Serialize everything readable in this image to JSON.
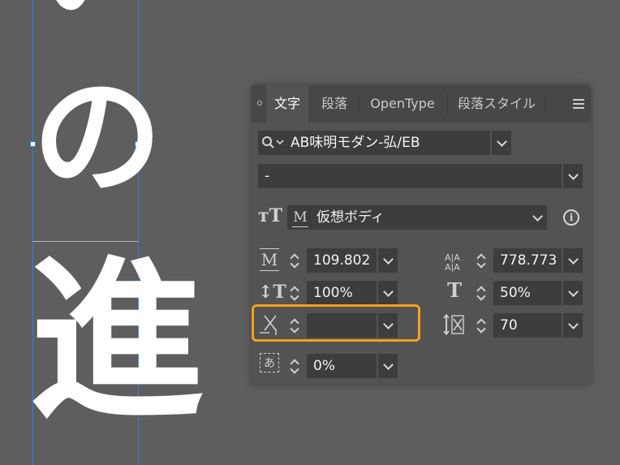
{
  "canvas": {
    "glyph_top": "い",
    "glyph_mid": "の",
    "glyph_bottom": "進"
  },
  "panel": {
    "tabs": [
      {
        "label": "文字",
        "active": true
      },
      {
        "label": "段落",
        "active": false
      },
      {
        "label": "OpenType",
        "active": false
      },
      {
        "label": "段落スタイル",
        "active": false
      }
    ],
    "font_family": "AB味明モダン-弘/EB",
    "font_style": "-",
    "baseline_icon_text": "M",
    "baseline": "仮想ボディ",
    "font_size": "109.802",
    "leading": "778.773",
    "vertical_scale": "100%",
    "horizontal_scale": "50%",
    "kerning": "",
    "tracking": "70",
    "tsume": "0%",
    "size_icon_text": "M",
    "tsume_icon_text": "あ"
  },
  "colors": {
    "highlight": "#f4a11d",
    "guide": "#2f7fe0",
    "panel_bg": "#535353"
  }
}
